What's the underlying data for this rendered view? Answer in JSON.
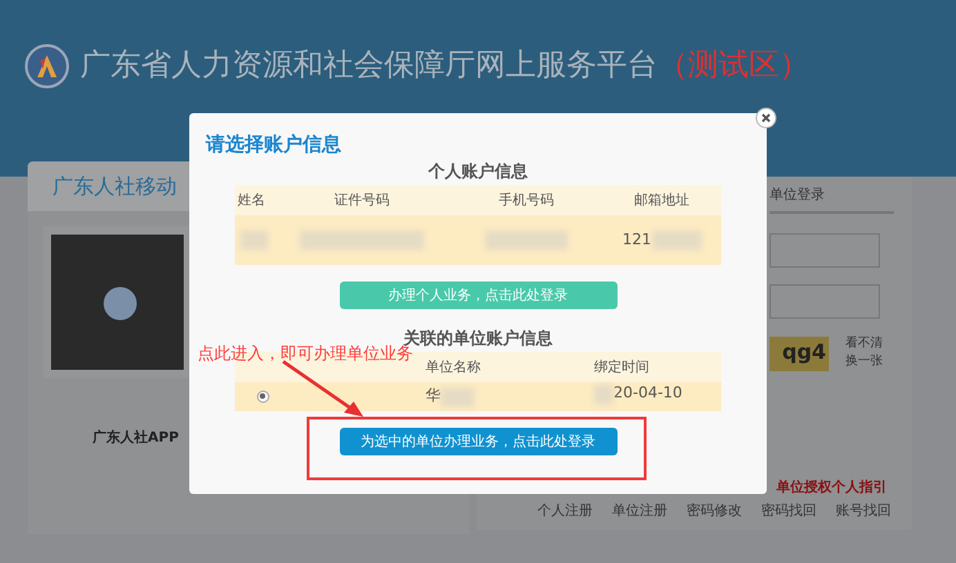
{
  "header": {
    "title": "广东省人力资源和社会保障厅网上服务平台",
    "badge": "（测试区）"
  },
  "left_panel": {
    "tab": "广东人社移动",
    "qr_caption": "广东人社APP"
  },
  "right_panel": {
    "tab": "单位登录",
    "captcha": "qg4",
    "refresh_hint": [
      "看不清",
      "换一张"
    ],
    "guide_link": "单位授权个人指引",
    "links": [
      "个人注册",
      "单位注册",
      "密码修改",
      "密码找回",
      "账号找回"
    ]
  },
  "dialog": {
    "title": "请选择账户信息",
    "personal": {
      "heading": "个人账户信息",
      "columns": [
        "姓名",
        "证件号码",
        "手机号码",
        "邮箱地址"
      ],
      "rows": [
        [
          "",
          "",
          "",
          "121"
        ]
      ],
      "button": "办理个人业务，点击此处登录"
    },
    "company": {
      "heading": "关联的单位账户信息",
      "columns": [
        "单位名称",
        "绑定时间"
      ],
      "rows": [
        {
          "selected": true,
          "name": "华",
          "date": "20-04-10"
        }
      ],
      "button": "为选中的单位办理业务，点击此处登录"
    }
  },
  "annotation": {
    "text": "点此进入，即可办理单位业务"
  }
}
